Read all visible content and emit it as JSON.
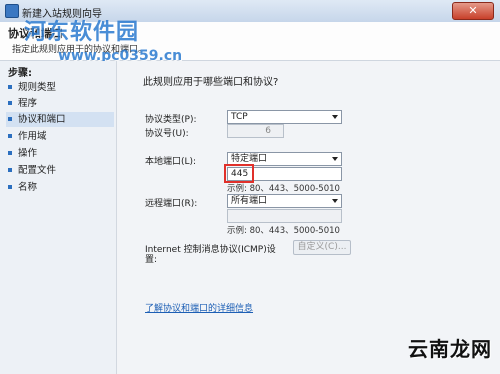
{
  "window": {
    "title": "新建入站规则向导",
    "close_label": "✕"
  },
  "header": {
    "title": "协议和端口",
    "subtitle": "指定此规则应用于的协议和端口。"
  },
  "watermarks": {
    "site_name": "河东软件园",
    "site_url": "www.pc0359.cn",
    "corner_logo": "云南龙网"
  },
  "sidebar": {
    "title": "步骤:",
    "items": [
      {
        "label": "规则类型"
      },
      {
        "label": "程序"
      },
      {
        "label": "协议和端口"
      },
      {
        "label": "作用域"
      },
      {
        "label": "操作"
      },
      {
        "label": "配置文件"
      },
      {
        "label": "名称"
      }
    ],
    "active_index": 2
  },
  "main": {
    "question": "此规则应用于哪些端口和协议?",
    "protocol_type": {
      "label": "协议类型(P):",
      "value": "TCP"
    },
    "protocol_number": {
      "label": "协议号(U):",
      "value": "6"
    },
    "local_port": {
      "label": "本地端口(L):",
      "value": "特定端口",
      "input_value": "445",
      "example": "示例: 80、443、5000-5010"
    },
    "remote_port": {
      "label": "远程端口(R):",
      "value": "所有端口",
      "input_value": "",
      "example": "示例: 80、443、5000-5010"
    },
    "icmp": {
      "label_line1": "Internet 控制消息协议(ICMP)设",
      "label_line2": "置:",
      "button": "自定义(C)..."
    },
    "learn_more_link": "了解协议和端口的详细信息"
  },
  "colors": {
    "accent": "#2c6fbf",
    "highlight_box": "#e0302a",
    "link": "#1d5fb5"
  }
}
